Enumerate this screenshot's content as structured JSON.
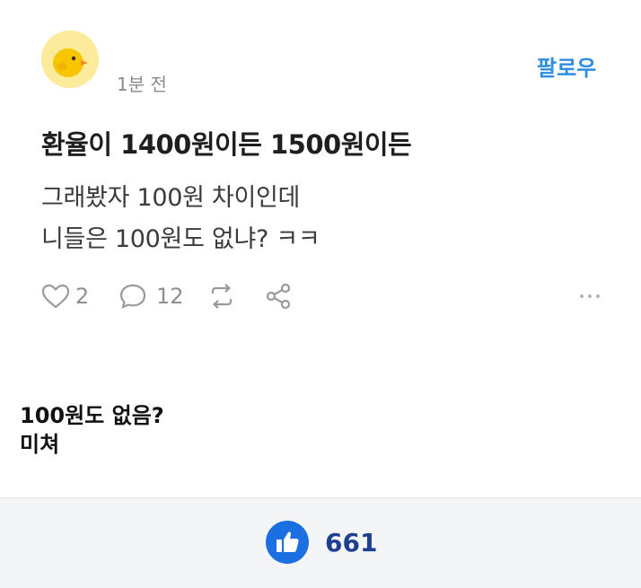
{
  "post": {
    "time": "1분 전",
    "follow_label": "팔로우",
    "title": "환율이 1400원이든 1500원이든",
    "body_line1": "그래봤자 100원 차이인데",
    "body_line2": "니들은 100원도 없냐? ㅋㅋ",
    "like_count": "2",
    "comment_count": "12",
    "avatar_icon": "duck-avatar-icon"
  },
  "comment": {
    "line1": "100원도 없음?",
    "line2": "미쳐"
  },
  "footer": {
    "like_total": "661",
    "like_icon": "thumbs-up-icon"
  },
  "colors": {
    "follow": "#2f8de4",
    "like_button": "#1b6fe0",
    "like_count": "#1d3f8f"
  }
}
